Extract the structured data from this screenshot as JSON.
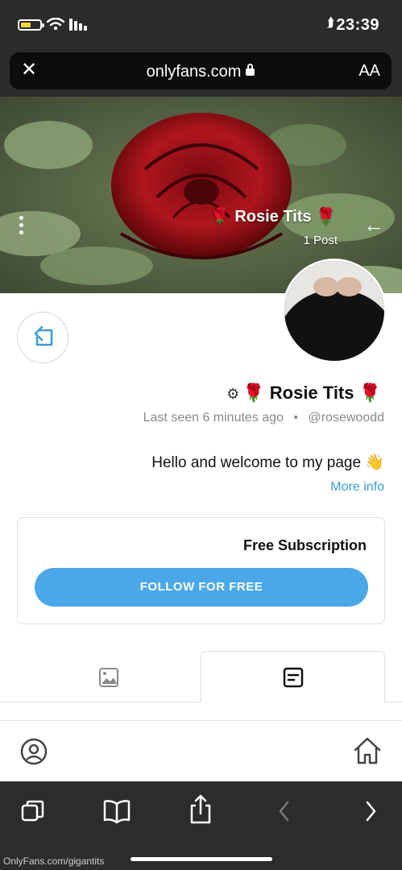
{
  "status_bar": {
    "time": "23:39",
    "location_glyph": "⮭"
  },
  "browser": {
    "url": "onlyfans.com",
    "close_glyph": "✕",
    "text_size_label": "AA"
  },
  "cover": {
    "name": "🌹 Rosie Tits 🌹",
    "posts": "1 Post",
    "back_glyph": "←"
  },
  "profile": {
    "name": "🌹 Rosie Tits 🌹",
    "handle": "@rosewoodd",
    "separator": "•",
    "last_seen": "Last seen 6 minutes ago",
    "bio": "Hello and welcome to my page 👋",
    "more_info": "More info"
  },
  "subscription": {
    "title": "Free Subscription",
    "button_label": "FOLLOW FOR FREE"
  },
  "tabs": [
    {
      "name": "posts",
      "icon": "posts-icon",
      "active": true
    },
    {
      "name": "media",
      "icon": "image-icon",
      "active": false
    }
  ],
  "site_nav": {
    "home_icon": "home-icon",
    "profile_icon": "user-circle-icon"
  },
  "safari_toolbar": {
    "icons": [
      "back-icon",
      "forward-icon",
      "share-icon",
      "bookmarks-icon",
      "tabs-icon"
    ]
  },
  "watermark": "OnlyFans.com/gigantits",
  "colors": {
    "accent": "#4aa8e8",
    "link": "#3b9bd8",
    "status_bar": "#2b2b2b",
    "battery": "#f5d33b",
    "rose": "#b0161e"
  }
}
